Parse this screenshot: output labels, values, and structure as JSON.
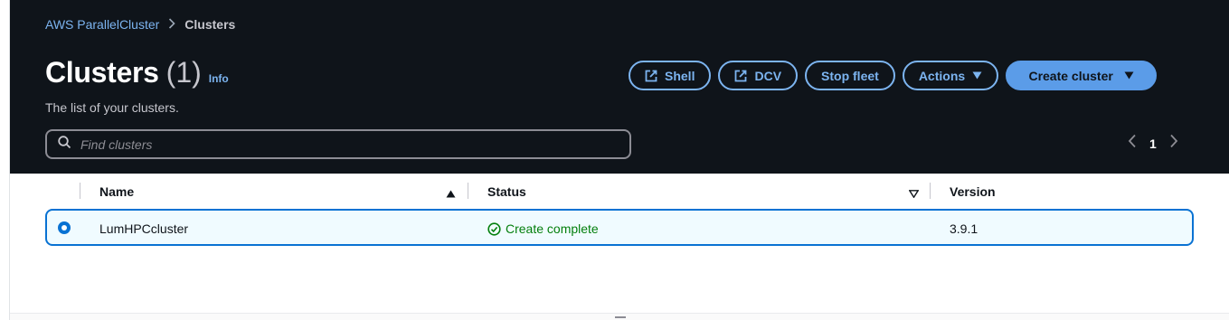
{
  "breadcrumb": {
    "root": "AWS ParallelCluster",
    "current": "Clusters"
  },
  "header": {
    "title": "Clusters",
    "count": "(1)",
    "info": "Info",
    "description": "The list of your clusters."
  },
  "toolbar": {
    "shell_label": "Shell",
    "dcv_label": "DCV",
    "stop_fleet_label": "Stop fleet",
    "actions_label": "Actions",
    "create_cluster_label": "Create cluster"
  },
  "search": {
    "placeholder": "Find clusters",
    "value": ""
  },
  "pagination": {
    "current_page": "1"
  },
  "table": {
    "columns": [
      "Name",
      "Status",
      "Version"
    ],
    "rows": [
      {
        "name": "LumHPCcluster",
        "status": "Create complete",
        "version": "3.9.1",
        "selected": true
      }
    ]
  },
  "colors": {
    "header_bg": "#0f141a",
    "link": "#7cb4f0",
    "primary": "#5b9ce8",
    "selected_border": "#0972d3",
    "success": "#037f0c"
  },
  "icons": {
    "breadcrumb_separator": "chevron-right-icon",
    "shell": "external-link-icon",
    "dcv": "external-link-icon",
    "actions": "caret-down-icon",
    "create_cluster": "caret-down-icon",
    "search": "search-icon",
    "pager_prev": "chevron-left-icon",
    "pager_next": "chevron-right-icon",
    "sort_name": "sort-ascending-icon",
    "sort_status": "sort-descending-icon",
    "status": "check-circle-icon"
  }
}
